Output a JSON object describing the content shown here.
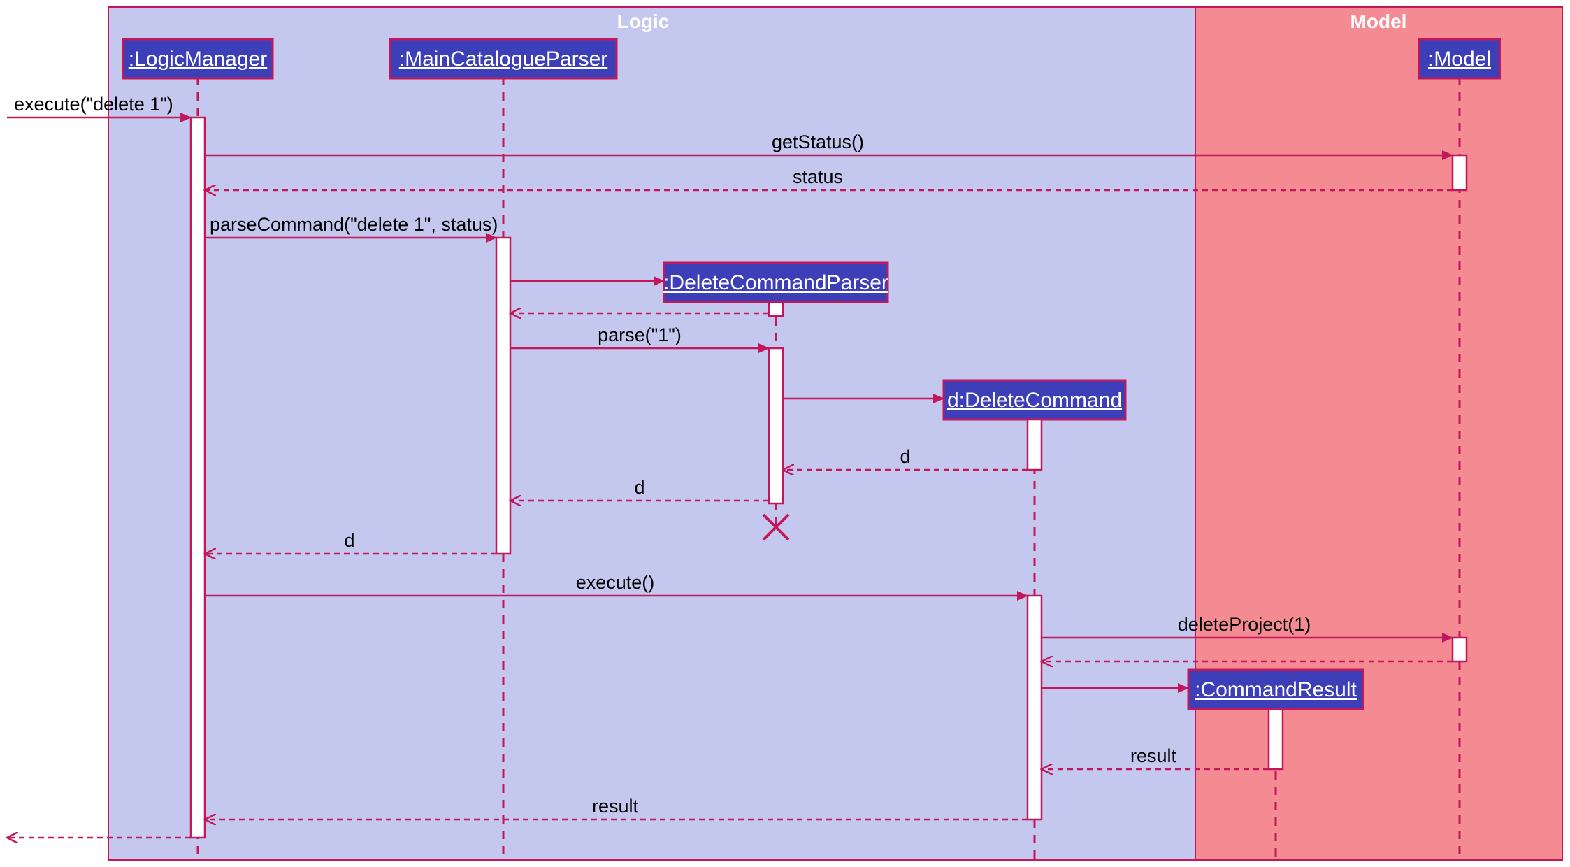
{
  "diagram": {
    "type": "uml-sequence",
    "frames": {
      "logic": {
        "label": "Logic"
      },
      "model": {
        "label": "Model"
      }
    },
    "participants": {
      "logicManager": ":LogicManager",
      "mainCatalogueParser": ":MainCatalogueParser",
      "deleteCommandParser": ":DeleteCommandParser",
      "deleteCommand": "d:DeleteCommand",
      "commandResult": ":CommandResult",
      "model": ":Model"
    },
    "messages": {
      "executeIn": "execute(\"delete 1\")",
      "getStatus": "getStatus()",
      "statusReturn": "status",
      "parseCommand": "parseCommand(\"delete 1\", status)",
      "parse": "parse(\"1\")",
      "dReturn1": "d",
      "dReturn2": "d",
      "dReturn3": "d",
      "execute": "execute()",
      "deleteProject": "deleteProject(1)",
      "resultReturn1": "result",
      "resultReturn2": "result"
    }
  }
}
